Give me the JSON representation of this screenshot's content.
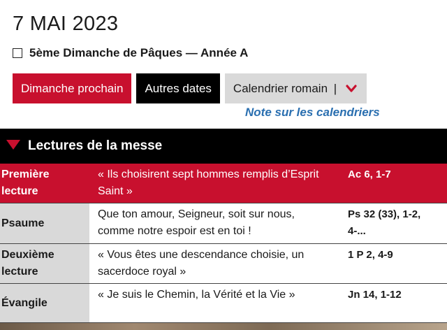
{
  "header": {
    "date": "7 MAI 2023",
    "feast": "5ème Dimanche de Pâques — Année A"
  },
  "buttons": {
    "next_sunday": "Dimanche prochain",
    "other_dates": "Autres dates",
    "calendar": "Calendrier romain",
    "calendar_sep": "|"
  },
  "note_link": "Note sur les calendriers",
  "section": {
    "title": "Lectures de la messe"
  },
  "readings": [
    {
      "label": "Première lecture",
      "text": "« Ils choisirent sept hommes remplis d’Esprit Saint »",
      "ref": "Ac 6, 1-7"
    },
    {
      "label": "Psaume",
      "text": "Que ton amour, Seigneur, soit sur nous, comme notre espoir est en toi !",
      "ref": "Ps 32 (33), 1-2, 4-..."
    },
    {
      "label": "Deuxième lecture",
      "text": "« Vous êtes une descendance choisie, un sacerdoce royal »",
      "ref": "1 P 2, 4-9"
    },
    {
      "label": "Évangile",
      "text": "« Je suis le Chemin, la Vérité et la Vie »",
      "ref": "Jn 14, 1-12"
    }
  ],
  "colors": {
    "accent_red": "#c8102e",
    "black": "#000000",
    "grey": "#d9d9d9",
    "link_blue": "#2a6fb0"
  },
  "icons": {
    "checkbox": "checkbox-icon",
    "chevron": "chevron-down-icon",
    "triangle": "triangle-down-icon"
  }
}
